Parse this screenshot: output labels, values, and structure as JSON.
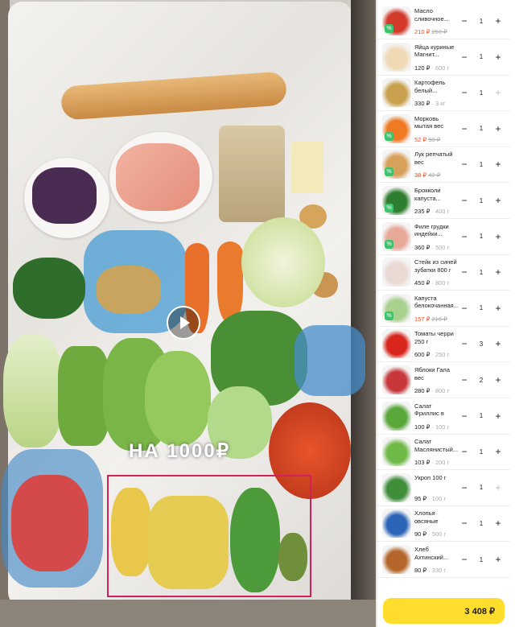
{
  "video": {
    "overlay_text": "НА 1000₽"
  },
  "products": [
    {
      "name": "Масло сливочное...",
      "price": "210 ₽",
      "old": "250 ₽",
      "unit": "",
      "qty": "1",
      "sale": true,
      "color": "#d33a2c"
    },
    {
      "name": "Яйца куриные Магнит...",
      "price": "120 ₽",
      "old": "",
      "unit": "· 600 г",
      "qty": "1",
      "sale": false,
      "color": "#f0d9b5"
    },
    {
      "name": "Картофель белый...",
      "price": "330 ₽",
      "old": "",
      "unit": "· 3 кг",
      "qty": "1",
      "sale": false,
      "color": "#c9a14e"
    },
    {
      "name": "Морковь мытая вес",
      "price": "52 ₽",
      "old": "58 ₽",
      "unit": "",
      "qty": "1",
      "sale": true,
      "color": "#f07a24"
    },
    {
      "name": "Лук репчатый вес",
      "price": "38 ₽",
      "old": "42 ₽",
      "unit": "",
      "qty": "1",
      "sale": true,
      "color": "#d8a15b"
    },
    {
      "name": "Брокколи капуста...",
      "price": "235 ₽",
      "old": "",
      "unit": "· 400 г",
      "qty": "1",
      "sale": true,
      "color": "#2f7d2f"
    },
    {
      "name": "Филе грудки индейки...",
      "price": "360 ₽",
      "old": "",
      "unit": "· 500 г",
      "qty": "1",
      "sale": true,
      "color": "#e7a99a"
    },
    {
      "name": "Стейк из синей зубатки 800 г",
      "price": "450 ₽",
      "old": "",
      "unit": "· 800 г",
      "qty": "1",
      "sale": false,
      "color": "#ead9d3"
    },
    {
      "name": "Капуста белокочанная...",
      "price": "157 ₽",
      "old": "216 ₽",
      "unit": "",
      "qty": "1",
      "sale": true,
      "color": "#a9d18e"
    },
    {
      "name": "Томаты черри 250 г",
      "price": "600 ₽",
      "old": "",
      "unit": "· 250 г",
      "qty": "3",
      "sale": false,
      "color": "#d9261c"
    },
    {
      "name": "Яблоки Гала вес",
      "price": "280 ₽",
      "old": "",
      "unit": "· 800 г",
      "qty": "2",
      "sale": false,
      "color": "#c8373a"
    },
    {
      "name": "Салат Фриллис в горшочке 10...",
      "price": "100 ₽",
      "old": "",
      "unit": "· 100 г",
      "qty": "1",
      "sale": false,
      "color": "#5aa83a"
    },
    {
      "name": "Салат Маслянистый...",
      "price": "103 ₽",
      "old": "",
      "unit": "· 200 г",
      "qty": "1",
      "sale": false,
      "color": "#6fba47"
    },
    {
      "name": "Укроп 100 г",
      "price": "95 ₽",
      "old": "",
      "unit": "· 100 г",
      "qty": "1",
      "sale": false,
      "color": "#3f8f3a"
    },
    {
      "name": "Хлопья овсяные Русский...",
      "price": "90 ₽",
      "old": "",
      "unit": "· 500 г",
      "qty": "1",
      "sale": false,
      "color": "#2c64b8"
    },
    {
      "name": "Хлеб Ахтинский...",
      "price": "80 ₽",
      "old": "",
      "unit": "· 330 г",
      "qty": "1",
      "sale": false,
      "color": "#b5662b"
    }
  ],
  "total": "3 408 ₽"
}
